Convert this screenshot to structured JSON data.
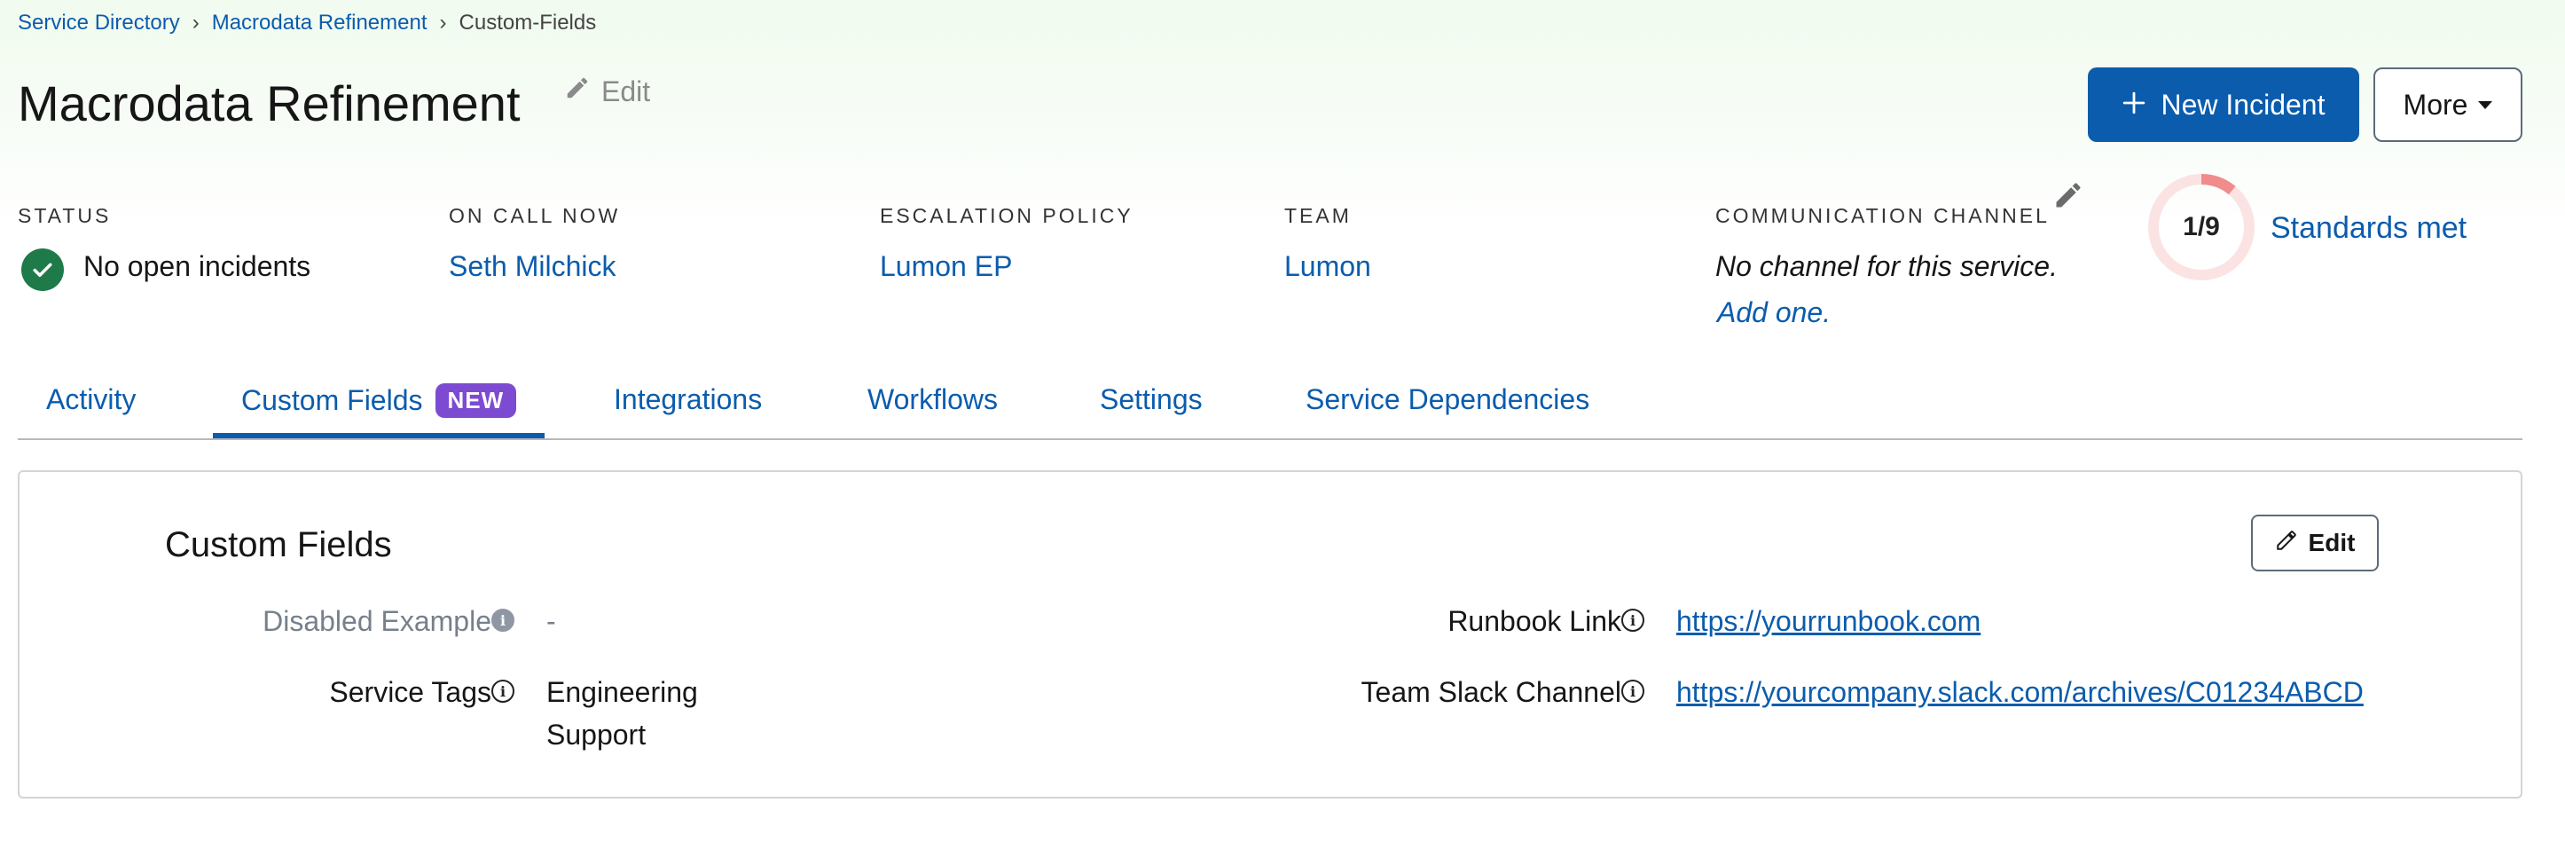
{
  "breadcrumb": {
    "items": [
      "Service Directory",
      "Macrodata Refinement"
    ],
    "current": "Custom-Fields",
    "separator": "›"
  },
  "header": {
    "title": "Macrodata Refinement",
    "edit_label": "Edit",
    "new_incident_label": "New Incident",
    "more_label": "More"
  },
  "summary": {
    "status": {
      "label": "STATUS",
      "value": "No open incidents"
    },
    "on_call": {
      "label": "ON CALL NOW",
      "value": "Seth Milchick"
    },
    "escalation": {
      "label": "ESCALATION POLICY",
      "value": "Lumon EP"
    },
    "team": {
      "label": "TEAM",
      "value": "Lumon"
    },
    "communication": {
      "label": "COMMUNICATION CHANNEL",
      "value": "No channel for this service.",
      "action": "Add one."
    },
    "standards": {
      "ratio": "1/9",
      "met": 1,
      "total": 9,
      "label": "Standards met"
    }
  },
  "tabs": [
    {
      "label": "Activity"
    },
    {
      "label": "Custom Fields",
      "badge": "NEW",
      "active": true
    },
    {
      "label": "Integrations"
    },
    {
      "label": "Workflows"
    },
    {
      "label": "Settings"
    },
    {
      "label": "Service Dependencies"
    }
  ],
  "custom_fields": {
    "title": "Custom Fields",
    "edit_label": "Edit",
    "left": [
      {
        "label": "Disabled Example",
        "value": "-",
        "disabled": true
      },
      {
        "label": "Service Tags",
        "values": [
          "Engineering",
          "Support"
        ]
      }
    ],
    "right": [
      {
        "label": "Runbook Link",
        "value": "https://yourrunbook.com"
      },
      {
        "label": "Team Slack Channel",
        "value": "https://yourcompany.slack.com/archives/C01234ABCD"
      }
    ]
  },
  "colors": {
    "link": "#0b5cad",
    "primary_button": "#0b5cad",
    "status_ok": "#1f7a4a",
    "badge_new": "#7d4bd1",
    "standards_ring": "#f08c8c"
  },
  "icons": {
    "status": "check-circle-icon",
    "edit": "pencil-icon",
    "new_incident": "plus-icon",
    "info": "info-icon"
  }
}
